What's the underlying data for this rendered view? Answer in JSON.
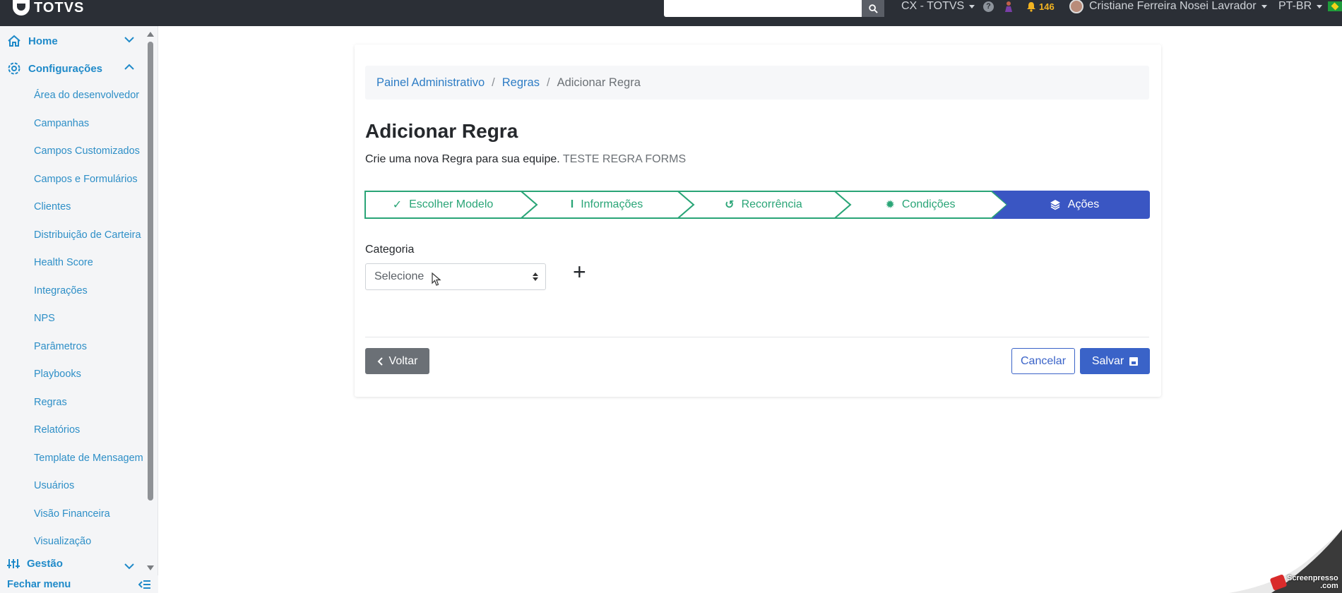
{
  "topbar": {
    "logo_text": "TOTVS",
    "search_placeholder": "",
    "workspace": "CX - TOTVS",
    "help": "?",
    "notification_count": "146",
    "user_name": "Cristiane Ferreira Nosei Lavrador",
    "language": "PT-BR"
  },
  "sidebar": {
    "top_items": [
      {
        "label": "Home"
      },
      {
        "label": "Configurações"
      }
    ],
    "config_items": [
      {
        "label": "Área do desenvolvedor"
      },
      {
        "label": "Campanhas"
      },
      {
        "label": "Campos Customizados"
      },
      {
        "label": "Campos e Formulários"
      },
      {
        "label": "Clientes"
      },
      {
        "label": "Distribuição de Carteira"
      },
      {
        "label": "Health Score"
      },
      {
        "label": "Integrações"
      },
      {
        "label": "NPS"
      },
      {
        "label": "Parâmetros"
      },
      {
        "label": "Playbooks"
      },
      {
        "label": "Regras"
      },
      {
        "label": "Relatórios"
      },
      {
        "label": "Template de Mensagem"
      },
      {
        "label": "Usuários"
      },
      {
        "label": "Visão Financeira"
      },
      {
        "label": "Visualização"
      }
    ],
    "bottom_item": {
      "label": "Gestão"
    },
    "close_menu": "Fechar menu"
  },
  "breadcrumb": {
    "items": [
      "Painel Administrativo",
      "Regras",
      "Adicionar Regra"
    ]
  },
  "page": {
    "title": "Adicionar Regra",
    "description": "Crie uma nova Regra para sua equipe.",
    "rule_name": "TESTE REGRA FORMS"
  },
  "stepper": {
    "steps": [
      {
        "label": "Escolher Modelo",
        "icon": "double-check-icon"
      },
      {
        "label": "Informações",
        "icon": "text-cursor-icon"
      },
      {
        "label": "Recorrência",
        "icon": "undo-icon"
      },
      {
        "label": "Condições",
        "icon": "gear-icon"
      },
      {
        "label": "Ações",
        "icon": "layers-icon"
      }
    ],
    "active_index": 4,
    "colors": {
      "done": "#2aa577",
      "active": "#3a56c3"
    }
  },
  "form": {
    "category_label": "Categoria",
    "category_value": "Selecione",
    "add_label": "+"
  },
  "actions": {
    "back": "Voltar",
    "cancel": "Cancelar",
    "save": "Salvar"
  },
  "watermark": {
    "text": "Screenpresso",
    "domain": ".com"
  }
}
